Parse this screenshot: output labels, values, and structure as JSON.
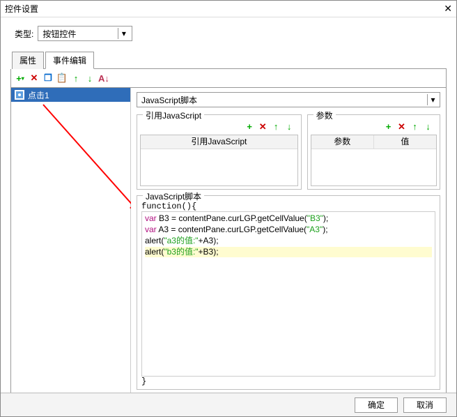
{
  "window": {
    "title": "控件设置"
  },
  "type": {
    "label": "类型:",
    "value": "按钮控件"
  },
  "tabs": {
    "properties": "属性",
    "events": "事件编辑"
  },
  "eventList": {
    "item1": "点击1"
  },
  "scriptSelect": {
    "value": "JavaScript脚本"
  },
  "refFieldset": {
    "legend": "引用JavaScript",
    "col1": "引用JavaScript"
  },
  "paramFieldset": {
    "legend": "参数",
    "col1": "参数",
    "col2": "值"
  },
  "codeFieldset": {
    "legend": "JavaScript脚本",
    "header": "function(){",
    "footer": "}"
  },
  "code": {
    "l1a": "var",
    "l1b": " B3 = contentPane.curLGP.getCellValue(",
    "l1c": "\"B3\"",
    "l1d": ");",
    "l2a": "var",
    "l2b": " A3 = contentPane.curLGP.getCellValue(",
    "l2c": "\"A3\"",
    "l2d": ");",
    "l3a": "alert(",
    "l3b": "\"a3的值:\"",
    "l3c": "+A3);",
    "l4a": "alert(",
    "l4b": "\"b3的值:\"",
    "l4c": "+B3);"
  },
  "buttons": {
    "ok": "确定",
    "cancel": "取消"
  }
}
